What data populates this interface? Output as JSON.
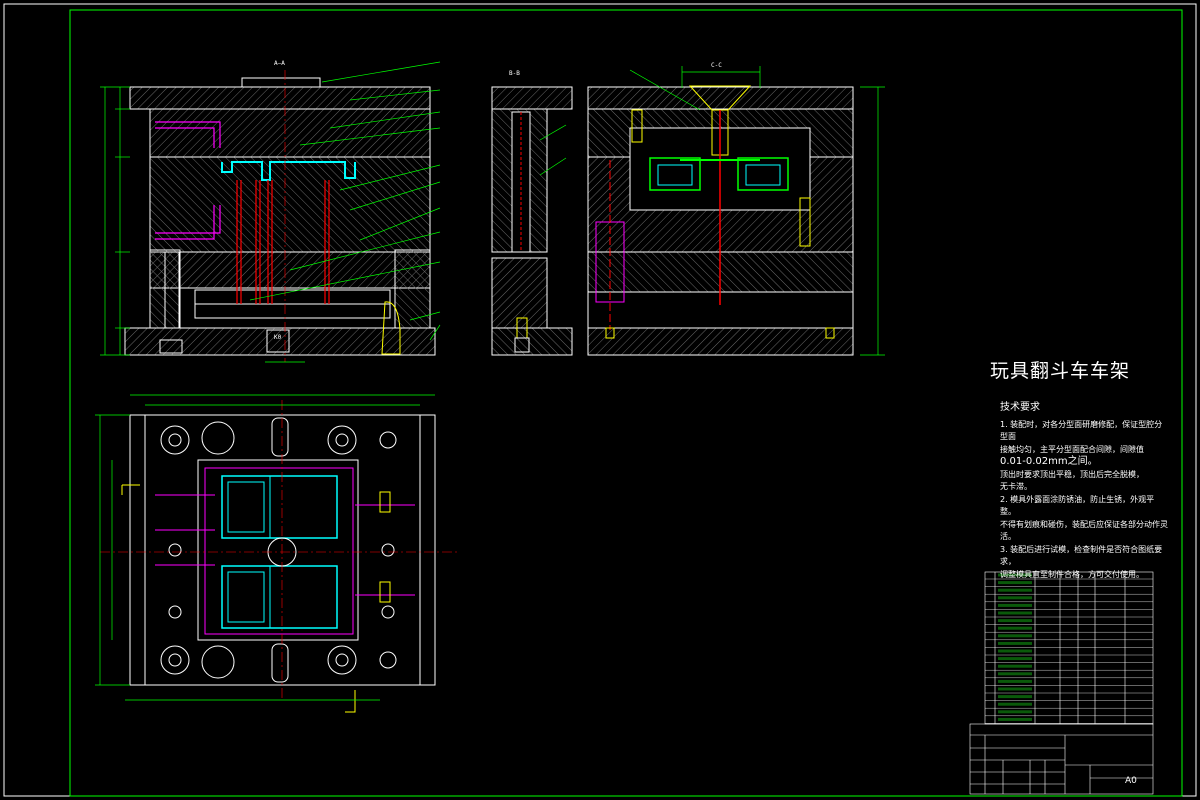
{
  "drawing": {
    "title": "玩具翻斗车车架",
    "sheet_size": "A0",
    "section_labels": [
      "A—A",
      "B-B",
      "C-C"
    ],
    "base_size_label": "K0"
  },
  "tech_requirements": {
    "heading": "技术要求",
    "items": [
      "1. 装配时，对各分型面研磨修配，保证型腔分型面",
      "接触均匀，主平分型面配合间隙，间隙值",
      "0.01-0.02mm之间。",
      "顶出时要求顶出平稳，顶出后完全脱模，",
      "无卡滞。",
      "2. 模具外露面涂防锈油，防止生锈，外观平整。",
      "不得有划痕和碰伤，装配后应保证各部分动作灵活。",
      "3. 装配后进行试模，检查制件是否符合图纸要求，",
      "调整模具直至制件合格，方可交付使用。"
    ]
  },
  "colors": {
    "background": "#000000",
    "outline": "#ffffff",
    "dimension": "#00ff00",
    "centerline": "#ff0000",
    "part": "#00ffff",
    "leader": "#ffff00",
    "hatch": "#808080",
    "pins": "#ff00ff"
  }
}
